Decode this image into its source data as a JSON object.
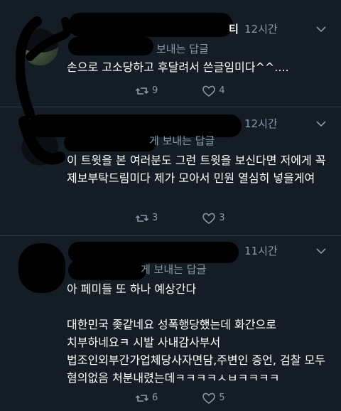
{
  "colors": {
    "background": "#141d26",
    "text_primary": "#ffffff",
    "text_secondary": "#8899a6",
    "divider": "#2a3744",
    "redaction": "#000000"
  },
  "tweets": [
    {
      "name_tail": "티",
      "time": "12시간",
      "reply_to": "보내는 답글",
      "text": "손으로 고소당하고 후달려서 쓴글임미다^^....",
      "retweets": "9",
      "likes": "4",
      "replies": ""
    },
    {
      "name_tail": "",
      "time": "12시간",
      "reply_to": "게 보내는 답글",
      "text": "이 트윗을 본 여러분도 그런 트윗을 보신다면 저에게 꼭 제보부탁드림미다 제가 모아서 민원 열심히 넣을게여",
      "retweets": "3",
      "likes": "3",
      "replies": ""
    },
    {
      "name_tail": "",
      "time": "11시간",
      "reply_to": "게 보내는 답글",
      "text": "아 페미들 또 하나 예상간다\n\n대한민국 좆같네요 성폭행당했는데 화간으로 치부하네요ㅋ 시발 사내감사부서 법조인외부간가업체당사자면담,주변인 증언, 검찰 모두 혐의없음 처분내렸는데ㅋㅋㅋㅋㅅㅂㅋㅋㅋㅋ",
      "retweets": "6",
      "likes": "5",
      "replies": ""
    }
  ],
  "icons": {
    "retweet": "retweet-icon",
    "like": "heart-icon",
    "menu": "chevron-down-icon"
  }
}
